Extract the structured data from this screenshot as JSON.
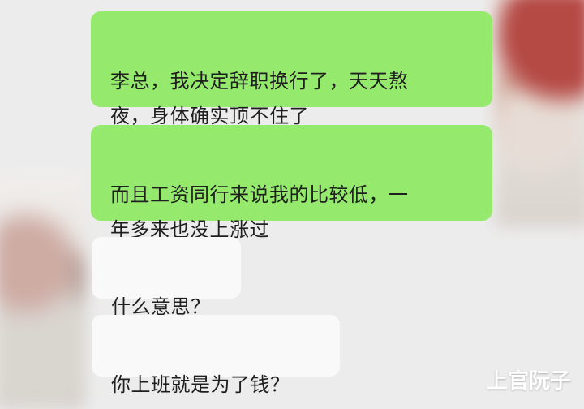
{
  "chat": {
    "messages": [
      {
        "sender": "me",
        "text": "李总，我决定辞职换行了，天天熬\n夜，身体确实顶不住了"
      },
      {
        "sender": "me",
        "text": "而且工资同行来说我的比较低，一\n年多来也没上涨过"
      },
      {
        "sender": "other",
        "text": "什么意思？"
      },
      {
        "sender": "other",
        "text": "你上班就是为了钱？"
      }
    ]
  },
  "watermark": {
    "text": "上官阮子"
  },
  "colors": {
    "background": "#ececec",
    "outgoing_bubble": "#95ea6d",
    "incoming_bubble": "#f9f9f9",
    "text": "#1f1f1f"
  },
  "icons": {
    "right_avatar": "blurred-avatar",
    "left_avatar": "blurred-avatar"
  }
}
